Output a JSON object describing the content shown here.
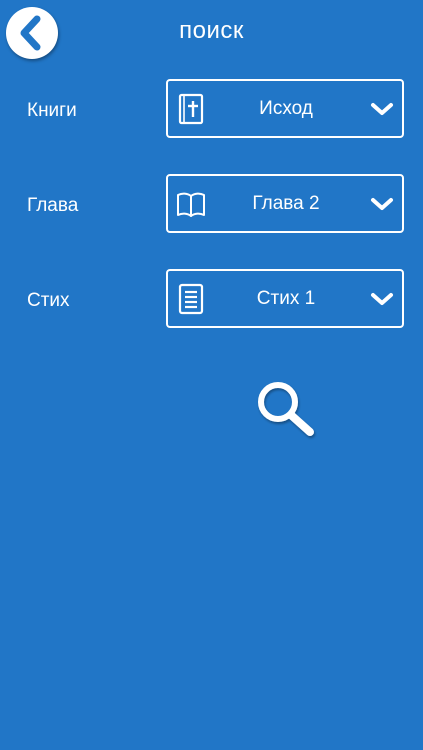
{
  "header": {
    "title": "поиск",
    "back_icon": "chevron-left-icon"
  },
  "rows": [
    {
      "label": "Книги",
      "value": "Исход",
      "icon": "bible-icon"
    },
    {
      "label": "Глава",
      "value": "Глава 2",
      "icon": "open-book-icon"
    },
    {
      "label": "Стих",
      "value": "Стих 1",
      "icon": "document-lines-icon"
    }
  ],
  "search": {
    "icon": "magnifier-icon"
  },
  "colors": {
    "background": "#2176c7",
    "foreground": "#ffffff",
    "back_chevron": "#2176c7"
  }
}
